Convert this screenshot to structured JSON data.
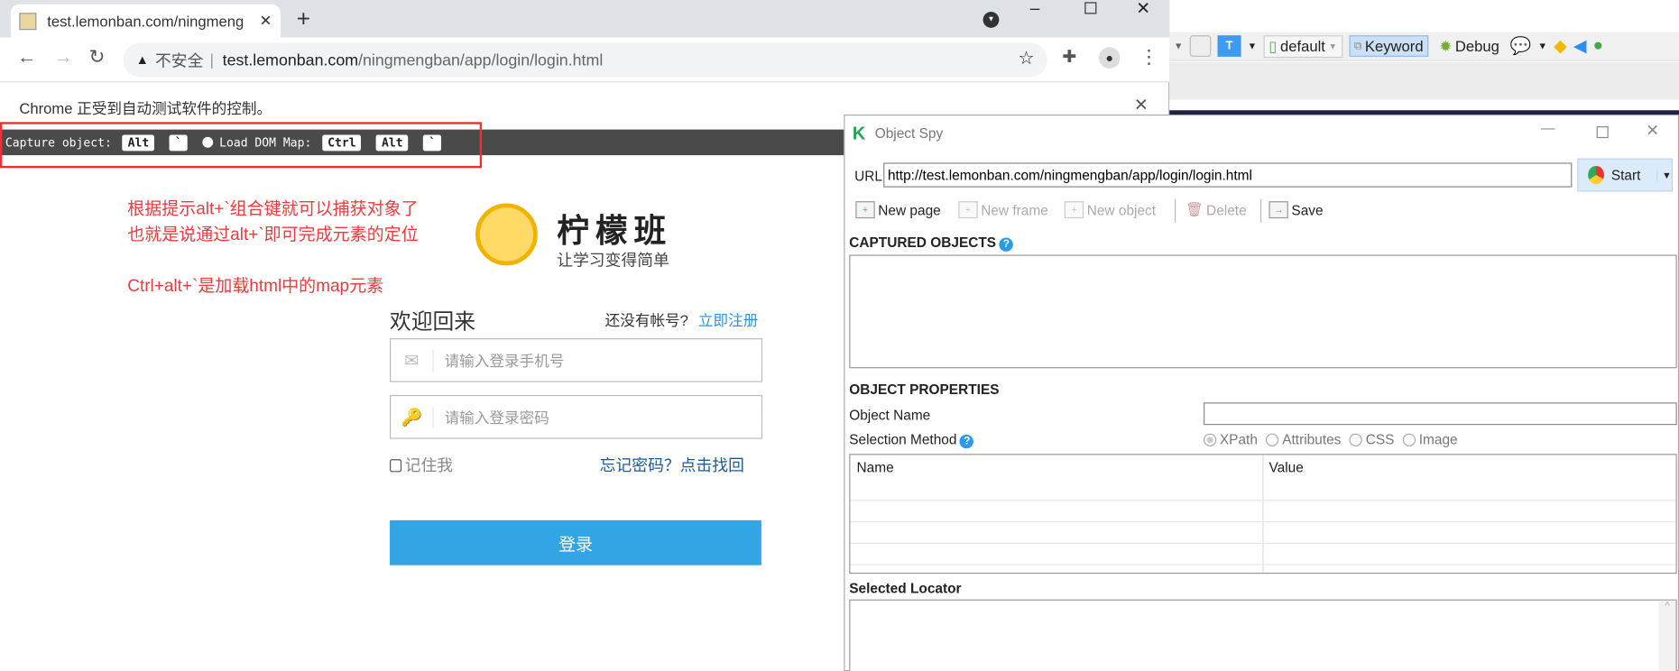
{
  "browser": {
    "tab_title": "test.lemonban.com/ningmeng",
    "insecure_label": "不安全",
    "url_host": "test.lemonban.com",
    "url_path": "/ningmengban/app/login/login.html",
    "automation_notice": "Chrome 正受到自动测试软件的控制。"
  },
  "spy_bar": {
    "capture_label": "Capture object:",
    "capture_keys": [
      "Alt",
      "`"
    ],
    "load_dom_label": "Load DOM Map:",
    "load_dom_keys": [
      "Ctrl",
      "Alt",
      "`"
    ]
  },
  "annotations": [
    "根据提示alt+`组合键就可以捕获对象了",
    "也就是说通过alt+`即可完成元素的定位",
    "Ctrl+alt+`是加载html中的map元素"
  ],
  "page": {
    "brand": "柠檬班",
    "slogan": "让学习变得简单",
    "welcome": "欢迎回来",
    "no_account": "还没有帐号?",
    "register_link": "立即注册",
    "phone_placeholder": "请输入登录手机号",
    "password_placeholder": "请输入登录密码",
    "remember_me": "记住我",
    "forgot_link": "忘记密码？点击找回",
    "login_button": "登录",
    "accent_color": "#33a5e5"
  },
  "eclipse_toolbar": {
    "profile": "default",
    "keyword": "Keyword",
    "debug": "Debug"
  },
  "object_spy": {
    "title": "Object Spy",
    "url_label": "URL",
    "url_value": "http://test.lemonban.com/ningmengban/app/login/login.html",
    "start_button": "Start",
    "toolbar": {
      "new_page": "New page",
      "new_frame": "New frame",
      "new_object": "New object",
      "delete": "Delete",
      "save": "Save"
    },
    "captured_objects": "CAPTURED OBJECTS",
    "object_properties": "OBJECT PROPERTIES",
    "object_name_label": "Object Name",
    "object_name_value": "",
    "selection_method_label": "Selection Method",
    "selection_methods": [
      "XPath",
      "Attributes",
      "CSS",
      "Image"
    ],
    "selected_method": "XPath",
    "table_headers": [
      "Name",
      "Value"
    ],
    "selected_locator": "Selected Locator"
  }
}
